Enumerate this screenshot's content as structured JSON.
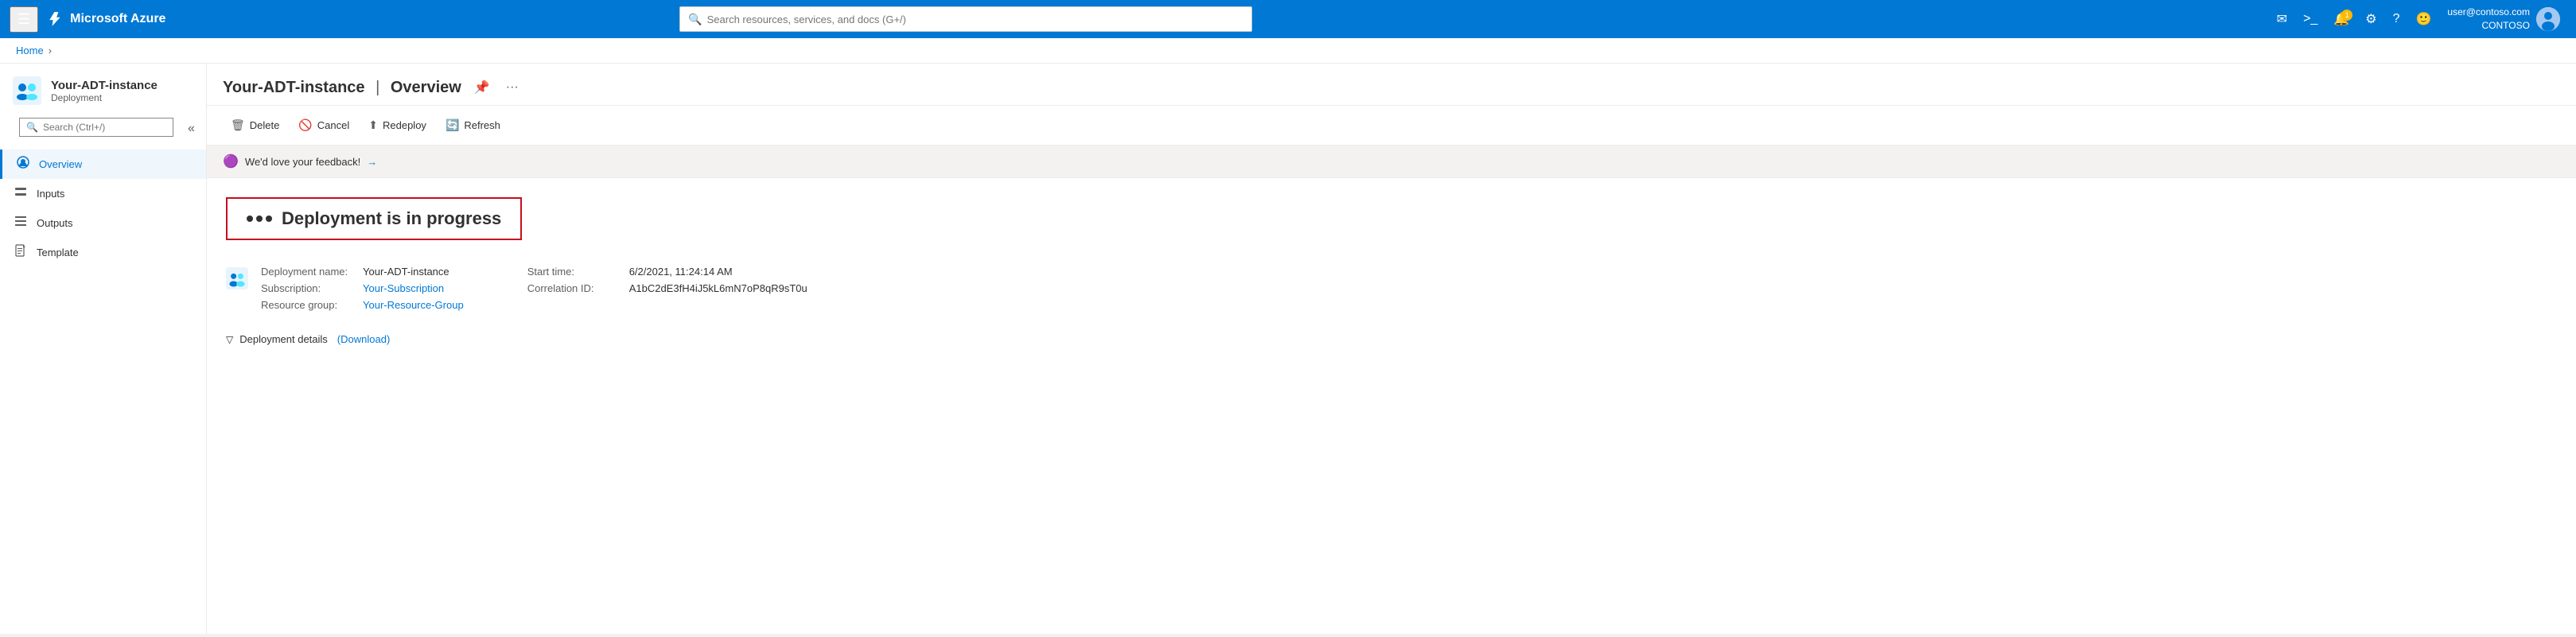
{
  "topnav": {
    "hamburger_label": "☰",
    "logo": "Microsoft Azure",
    "search_placeholder": "Search resources, services, and docs (G+/)",
    "icons": {
      "email": "✉",
      "chat": "💬",
      "notification": "🔔",
      "notification_count": "1",
      "settings": "⚙",
      "help": "?",
      "feedback": "🙂"
    },
    "user": {
      "email": "user@contoso.com",
      "org": "CONTOSO"
    }
  },
  "breadcrumb": {
    "home": "Home",
    "separator": "›"
  },
  "resource": {
    "name": "Your-ADT-instance",
    "section": "Overview",
    "subtitle": "Deployment"
  },
  "toolbar": {
    "delete_label": "Delete",
    "cancel_label": "Cancel",
    "redeploy_label": "Redeploy",
    "refresh_label": "Refresh"
  },
  "feedback": {
    "text": "We'd love your feedback!",
    "arrow": "→"
  },
  "deployment": {
    "status_text": "Deployment is in progress",
    "dots": [
      "•",
      "•",
      "•"
    ],
    "icon_alt": "ADT instance icon",
    "name_label": "Deployment name:",
    "name_value": "Your-ADT-instance",
    "subscription_label": "Subscription:",
    "subscription_value": "Your-Subscription",
    "resource_group_label": "Resource group:",
    "resource_group_value": "Your-Resource-Group",
    "start_time_label": "Start time:",
    "start_time_value": "6/2/2021, 11:24:14 AM",
    "correlation_label": "Correlation ID:",
    "correlation_value": "A1bC2dE3fH4iJ5kL6mN7oP8qR9sT0u",
    "details_label": "Deployment details",
    "download_label": "(Download)"
  },
  "sidebar": {
    "search_placeholder": "Search (Ctrl+/)",
    "collapse_icon": "«",
    "nav_items": [
      {
        "id": "overview",
        "label": "Overview",
        "icon": "👤",
        "active": true
      },
      {
        "id": "inputs",
        "label": "Inputs",
        "icon": "⌨"
      },
      {
        "id": "outputs",
        "label": "Outputs",
        "icon": "≡"
      },
      {
        "id": "template",
        "label": "Template",
        "icon": "📄"
      }
    ]
  }
}
